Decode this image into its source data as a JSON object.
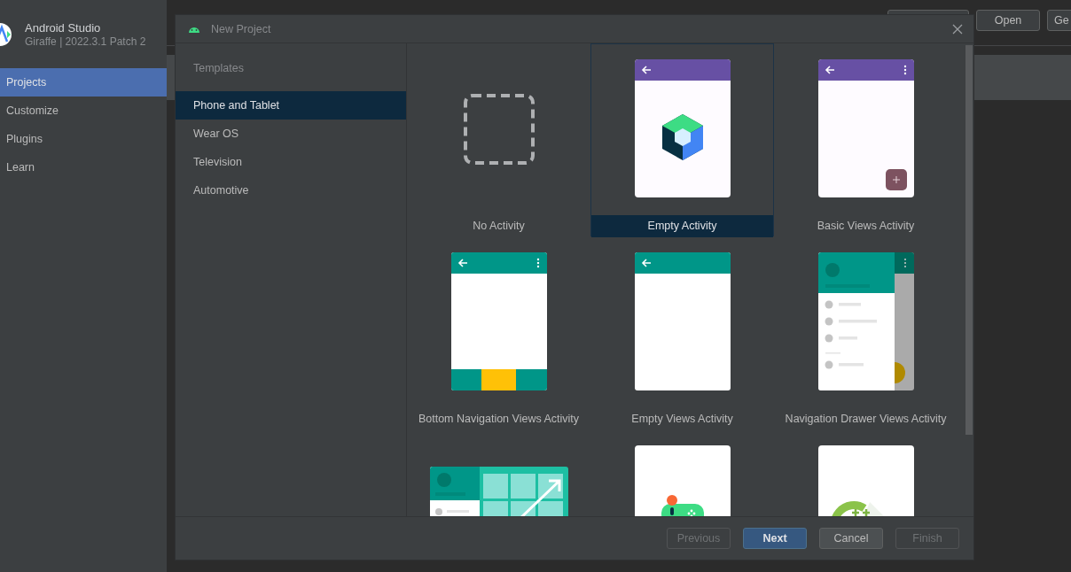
{
  "app": {
    "title": "Android Studio",
    "version": "Giraffe | 2022.3.1 Patch 2"
  },
  "sidebar": {
    "items": [
      {
        "label": "Projects",
        "selected": true
      },
      {
        "label": "Customize",
        "selected": false
      },
      {
        "label": "Plugins",
        "selected": false
      },
      {
        "label": "Learn",
        "selected": false
      }
    ]
  },
  "toolbar": {
    "buttons": [
      "Open",
      "Ge"
    ]
  },
  "dialog": {
    "title": "New Project",
    "templates_heading": "Templates",
    "categories": [
      {
        "label": "Phone and Tablet",
        "selected": true
      },
      {
        "label": "Wear OS",
        "selected": false
      },
      {
        "label": "Television",
        "selected": false
      },
      {
        "label": "Automotive",
        "selected": false
      }
    ],
    "templates": [
      {
        "kind": "none",
        "label": "No Activity",
        "selected": false
      },
      {
        "kind": "compose",
        "label": "Empty Activity",
        "selected": true
      },
      {
        "kind": "basic",
        "label": "Basic Views Activity",
        "selected": false
      },
      {
        "kind": "bottomnav",
        "label": "Bottom Navigation Views Activity",
        "selected": false
      },
      {
        "kind": "emptyviews",
        "label": "Empty Views Activity",
        "selected": false
      },
      {
        "kind": "drawer",
        "label": "Navigation Drawer Views Activity",
        "selected": false
      },
      {
        "kind": "responsive",
        "selected": false
      },
      {
        "kind": "game",
        "selected": false
      },
      {
        "kind": "cpp",
        "selected": false
      }
    ],
    "buttons": [
      {
        "label": "Previous",
        "disabled": true,
        "default": false
      },
      {
        "label": "Next",
        "disabled": false,
        "default": true
      },
      {
        "label": "Cancel",
        "disabled": false,
        "default": false
      },
      {
        "label": "Finish",
        "disabled": true,
        "default": false
      }
    ]
  }
}
